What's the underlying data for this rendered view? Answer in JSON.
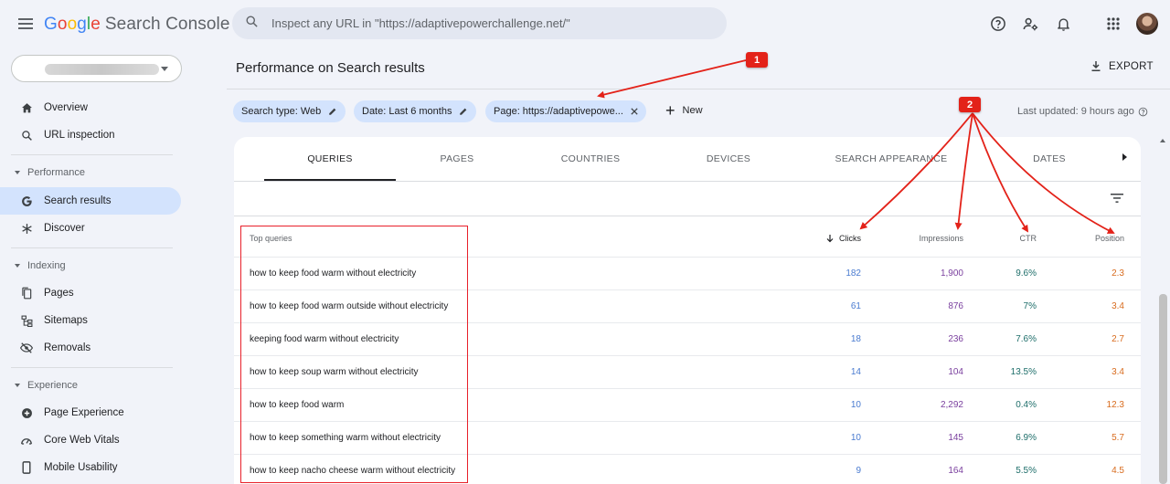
{
  "header": {
    "app_name_parts": [
      "G",
      "o",
      "o",
      "g",
      "l",
      "e"
    ],
    "app_name_rest": "Search Console",
    "search_placeholder": "Inspect any URL in \"https://adaptivepowerchallenge.net/\""
  },
  "top_icons": [
    "help-icon",
    "manage-users-icon",
    "notifications-bell-icon",
    "apps-grid-icon"
  ],
  "sidebar": {
    "items": [
      {
        "label": "Overview",
        "icon": "home-icon"
      },
      {
        "label": "URL inspection",
        "icon": "search-icon"
      },
      {
        "section": "Performance"
      },
      {
        "label": "Search results",
        "icon": "google-g-icon",
        "active": true
      },
      {
        "label": "Discover",
        "icon": "asterisk-icon"
      },
      {
        "section": "Indexing"
      },
      {
        "label": "Pages",
        "icon": "pages-icon"
      },
      {
        "label": "Sitemaps",
        "icon": "sitemap-icon"
      },
      {
        "label": "Removals",
        "icon": "removals-icon"
      },
      {
        "section": "Experience"
      },
      {
        "label": "Page Experience",
        "icon": "plus-circle-icon"
      },
      {
        "label": "Core Web Vitals",
        "icon": "gauge-icon"
      },
      {
        "label": "Mobile Usability",
        "icon": "phone-icon"
      }
    ]
  },
  "main": {
    "title": "Performance on Search results",
    "export_label": "EXPORT",
    "chips": [
      "Search type: Web",
      "Date: Last 6 months",
      "Page: https://adaptivepowe..."
    ],
    "new_label": "New",
    "last_updated": "Last updated: 9 hours ago",
    "tabs": [
      "QUERIES",
      "PAGES",
      "COUNTRIES",
      "DEVICES",
      "SEARCH APPEARANCE",
      "DATES"
    ],
    "table": {
      "headers": {
        "query": "Top queries",
        "clicks": "Clicks",
        "impressions": "Impressions",
        "ctr": "CTR",
        "position": "Position"
      },
      "rows": [
        {
          "query": "how to keep food warm without electricity",
          "clicks": "182",
          "impressions": "1,900",
          "ctr": "9.6%",
          "position": "2.3"
        },
        {
          "query": "how to keep food warm outside without electricity",
          "clicks": "61",
          "impressions": "876",
          "ctr": "7%",
          "position": "3.4"
        },
        {
          "query": "keeping food warm without electricity",
          "clicks": "18",
          "impressions": "236",
          "ctr": "7.6%",
          "position": "2.7"
        },
        {
          "query": "how to keep soup warm without electricity",
          "clicks": "14",
          "impressions": "104",
          "ctr": "13.5%",
          "position": "3.4"
        },
        {
          "query": "how to keep food warm",
          "clicks": "10",
          "impressions": "2,292",
          "ctr": "0.4%",
          "position": "12.3"
        },
        {
          "query": "how to keep something warm without electricity",
          "clicks": "10",
          "impressions": "145",
          "ctr": "6.9%",
          "position": "5.7"
        },
        {
          "query": "how to keep nacho cheese warm without electricity",
          "clicks": "9",
          "impressions": "164",
          "ctr": "5.5%",
          "position": "4.5"
        }
      ]
    }
  },
  "annotations": {
    "badge1": "1",
    "badge2": "2",
    "color": "#e32219"
  },
  "colors": {
    "clicks": "#4a7bd0",
    "impressions": "#7a3f9e",
    "ctr": "#1e6e6a",
    "position": "#d86c1f",
    "active_nav": "#d3e3fd"
  }
}
